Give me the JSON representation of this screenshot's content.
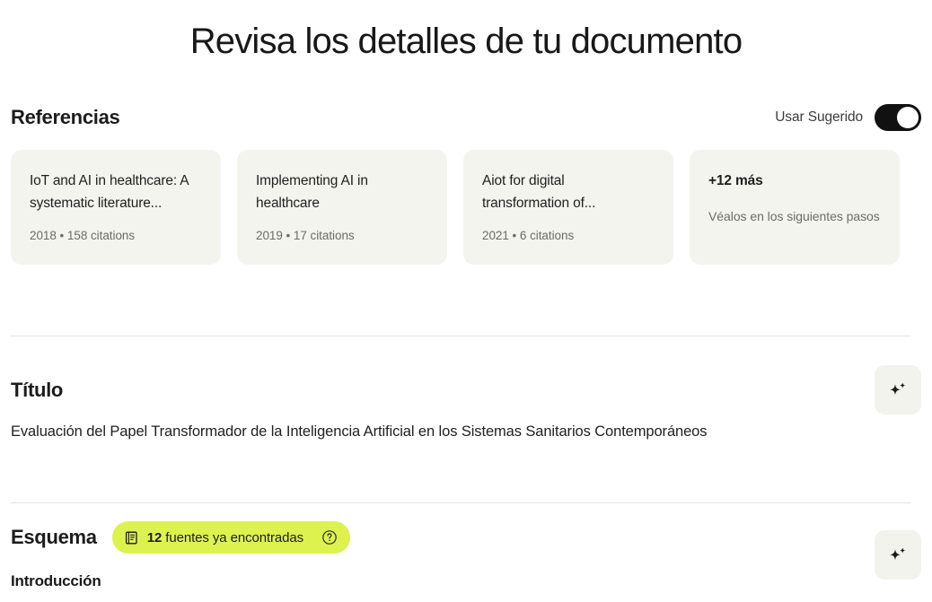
{
  "page": {
    "title": "Revisa los detalles de tu documento"
  },
  "references": {
    "heading": "Referencias",
    "toggle": {
      "label": "Usar Sugerido",
      "state": "on",
      "icon": "toggle-switch-icon"
    },
    "cards": [
      {
        "title": "IoT and AI in healthcare: A systematic literature...",
        "year": "2018",
        "separator": "•",
        "citations": "158 citations",
        "meta": "2018  •  158 citations"
      },
      {
        "title": "Implementing AI in healthcare",
        "year": "2019",
        "separator": "•",
        "citations": "17 citations",
        "meta": "2019  •  17 citations"
      },
      {
        "title": "Aiot for digital transformation of...",
        "year": "2021",
        "separator": "•",
        "citations": "6 citations",
        "meta": "2021  •  6 citations"
      }
    ],
    "more_card": {
      "title": "+12 más",
      "subtitle": "Véalos en los siguientes pasos"
    }
  },
  "titulo": {
    "heading": "Título",
    "value": "Evaluación del Papel Transformador de la Inteligencia Artificial en los Sistemas Sanitarios Contemporáneos",
    "ai_button_icon": "sparkle-icon"
  },
  "esquema": {
    "heading": "Esquema",
    "badge": {
      "icon": "book-icon",
      "count": "12",
      "text": "fuentes ya encontradas",
      "full_text": "12 fuentes ya encontradas",
      "help_icon": "help-circle-icon",
      "color": "#ddf24f"
    },
    "ai_button_icon": "sparkle-icon",
    "outline": [
      {
        "label": "Introducción"
      }
    ]
  },
  "colors": {
    "accent_badge": "#ddf24f",
    "card_background": "#f4f4ef",
    "toggle_on": "#111111",
    "divider": "#e3e3e1",
    "text_primary": "#1a1a1a",
    "text_muted": "#6b6b68"
  }
}
